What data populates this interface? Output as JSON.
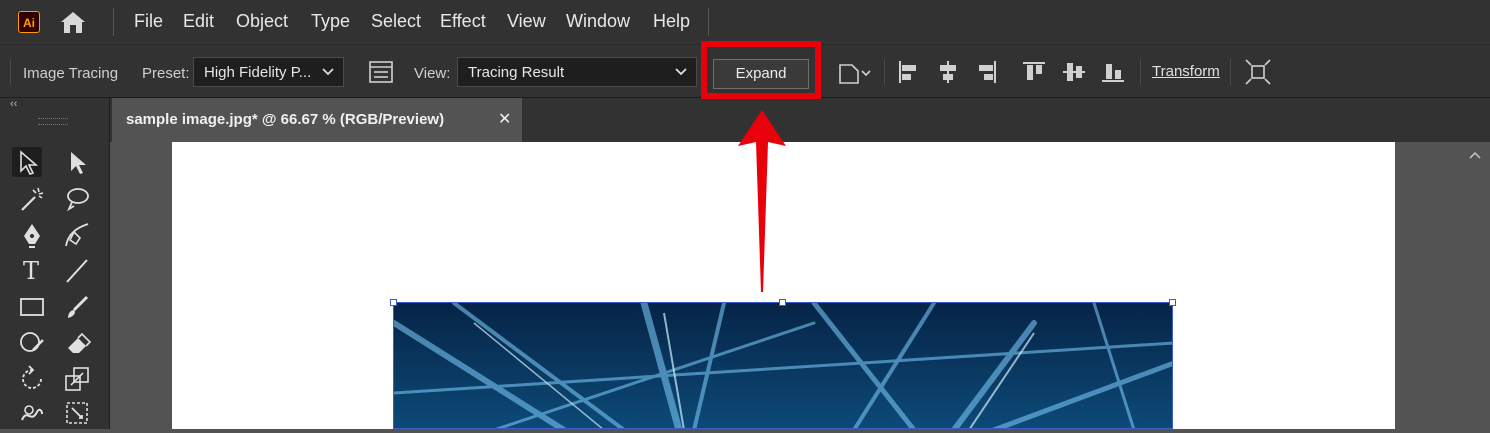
{
  "app": {
    "logo_text": "Ai"
  },
  "menubar": {
    "items": [
      "File",
      "Edit",
      "Object",
      "Type",
      "Select",
      "Effect",
      "View",
      "Window",
      "Help"
    ]
  },
  "control_bar": {
    "panel_label": "Image Tracing",
    "preset_label": "Preset:",
    "preset_value": "High Fidelity P...",
    "view_label": "View:",
    "view_value": "Tracing Result",
    "expand_label": "Expand",
    "transform_label": "Transform"
  },
  "document_tab": {
    "title": "sample image.jpg* @ 66.67 % (RGB/Preview)",
    "close_glyph": "✕"
  },
  "toolbar": {
    "collapse_glyph": "‹‹",
    "type_tool_glyph": "T"
  },
  "colors": {
    "annotation_red": "#e8000b",
    "selection_blue": "#3a5fcc",
    "ui_dark": "#323232",
    "canvas_gray": "#535353"
  }
}
